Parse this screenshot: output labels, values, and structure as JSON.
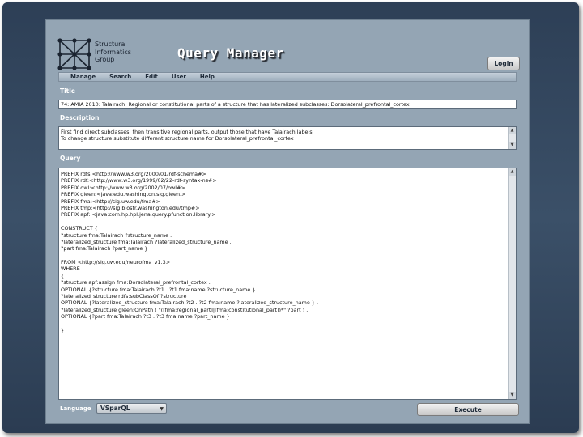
{
  "header": {
    "logo_lines": [
      "Structural",
      "Informatics",
      "Group"
    ],
    "app_title": "Query Manager",
    "login_label": "Login"
  },
  "menu": [
    "Manage",
    "Search",
    "Edit",
    "User",
    "Help"
  ],
  "title_section": {
    "label": "Title",
    "value": "74: AMIA 2010: Talairach: Regional or constitutional parts of a structure that has lateralized subclasses: Dorsolateral_prefrontal_cortex"
  },
  "description_section": {
    "label": "Description",
    "lines": [
      "First find direct subclasses, then transitive regional parts, output those that have Talairach labels.",
      "To change structure substitute different structure name for Dorsolateral_prefrontal_cortex"
    ]
  },
  "query_section": {
    "label": "Query",
    "lines": [
      "PREFIX rdfs:<http://www.w3.org/2000/01/rdf-schema#>",
      "PREFIX rdf:<http://www.w3.org/1999/02/22-rdf-syntax-ns#>",
      "PREFIX owl:<http://www.w3.org/2002/07/owl#>",
      "PREFIX gleen:<java:edu.washington.sig.gleen.>",
      "PREFIX fma:<http://sig.uw.edu/fma#>",
      "PREFIX tmp:<http://sig.biostr.washington.edu/tmp#>",
      "PREFIX apf: <java:com.hp.hpl.jena.query.pfunction.library.>",
      "",
      "CONSTRUCT {",
      "?structure fma:Talairach ?structure_name .",
      "?lateralized_structure fma:Talairach ?lateralized_structure_name .",
      "?part fma:Talairach ?part_name }",
      "",
      "FROM <http://sig.uw.edu/neurofma_v1.3>",
      "WHERE",
      "{",
      "?structure apf:assign fma:Dorsolateral_prefrontal_cortex .",
      "OPTIONAL {?structure fma:Talairach ?t1 . ?t1 fma:name ?structure_name } .",
      "?lateralized_structure rdfs:subClassOf ?structure .",
      "OPTIONAL {?lateralized_structure fma:Talairach ?t2 . ?t2 fma:name ?lateralized_structure_name } .",
      "?lateralized_structure gleen:OnPath ( \"([fma:regional_part]|[fma:constitutional_part])*\" ?part ) .",
      "OPTIONAL {?part fma:Talairach ?t3 . ?t3 fma:name ?part_name }",
      "",
      "}"
    ]
  },
  "footer": {
    "language_label": "Language",
    "language_value": "VSparQL",
    "execute_label": "Execute"
  }
}
